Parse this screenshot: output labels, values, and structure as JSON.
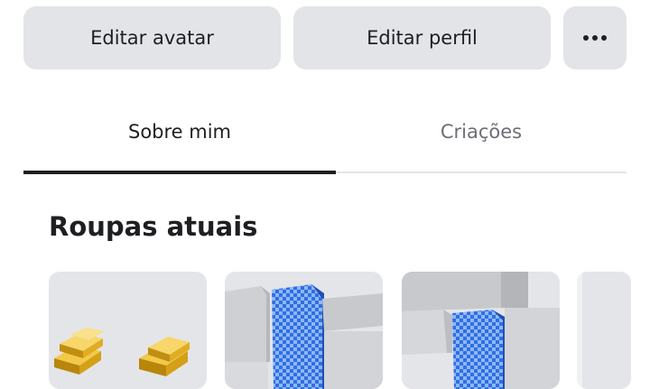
{
  "actions": {
    "edit_avatar": "Editar avatar",
    "edit_profile": "Editar perfil",
    "more_icon": "more-horizontal-icon"
  },
  "tabs": [
    {
      "label": "Sobre mim",
      "active": true
    },
    {
      "label": "Criações",
      "active": false
    }
  ],
  "section": {
    "title": "Roupas atuais"
  },
  "outfit_items": [
    {
      "thumbnail": "gold-bars"
    },
    {
      "thumbnail": "blue-checkered-pants"
    },
    {
      "thumbnail": "blue-checkered-pants"
    },
    {
      "thumbnail": "partial-item"
    }
  ],
  "colors": {
    "button_bg": "#e3e4e8",
    "text_primary": "#1e1f22",
    "text_secondary": "#6d6f75",
    "accent_blue": "#2f6fe0"
  }
}
